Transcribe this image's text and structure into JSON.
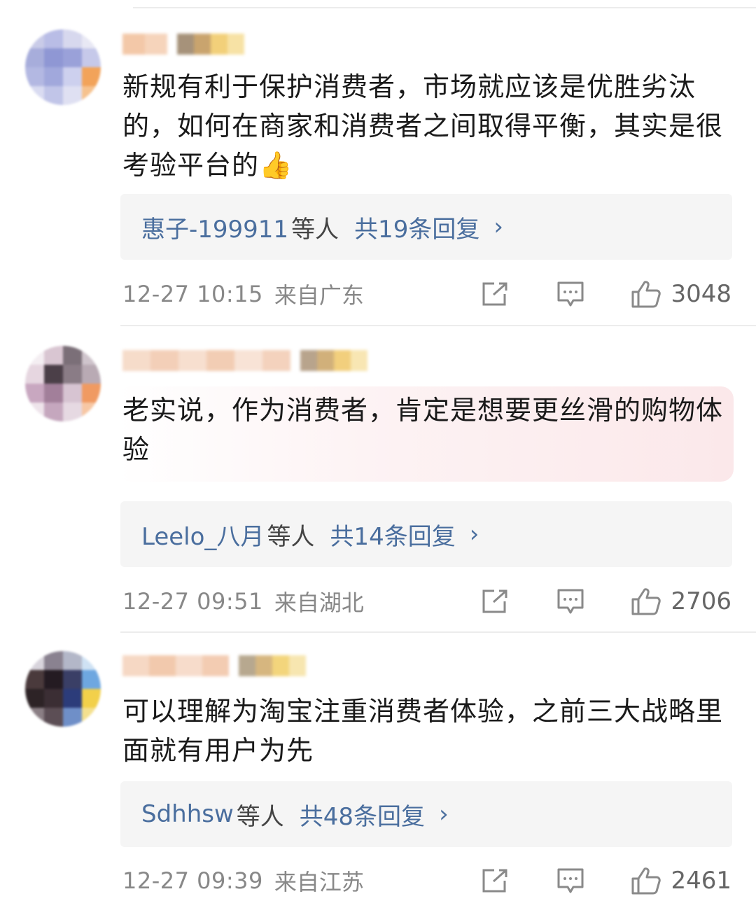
{
  "comments": [
    {
      "text": "新规有利于保护消费者，市场就应该是优胜劣汰的，如何在商家和消费者之间取得平衡，其实是很考验平台的👍",
      "reply_names": "惠子-199911",
      "reply_etc": "等人",
      "reply_count": "共19条回复",
      "chevron": "›",
      "time": "12-27 10:15",
      "location": "来自广东",
      "likes": "3048"
    },
    {
      "text": "老实说，作为消费者，肯定是想要更丝滑的购物体验",
      "reply_names": "Leelo_八月",
      "reply_etc": "等人",
      "reply_count": "共14条回复",
      "chevron": "›",
      "time": "12-27 09:51",
      "location": "来自湖北",
      "likes": "2706"
    },
    {
      "text": "可以理解为淘宝注重消费者体验，之前三大战略里面就有用户为先",
      "reply_names": "Sdhhsw",
      "reply_etc": "等人",
      "reply_count": "共48条回复",
      "chevron": "›",
      "time": "12-27 09:39",
      "location": "来自江苏",
      "likes": "2461"
    }
  ],
  "colors": {
    "link": "#4a6e9e",
    "meta": "#888888",
    "reply_bg": "#f5f5f5"
  },
  "icons": [
    "share-icon",
    "comment-icon",
    "like-icon"
  ]
}
